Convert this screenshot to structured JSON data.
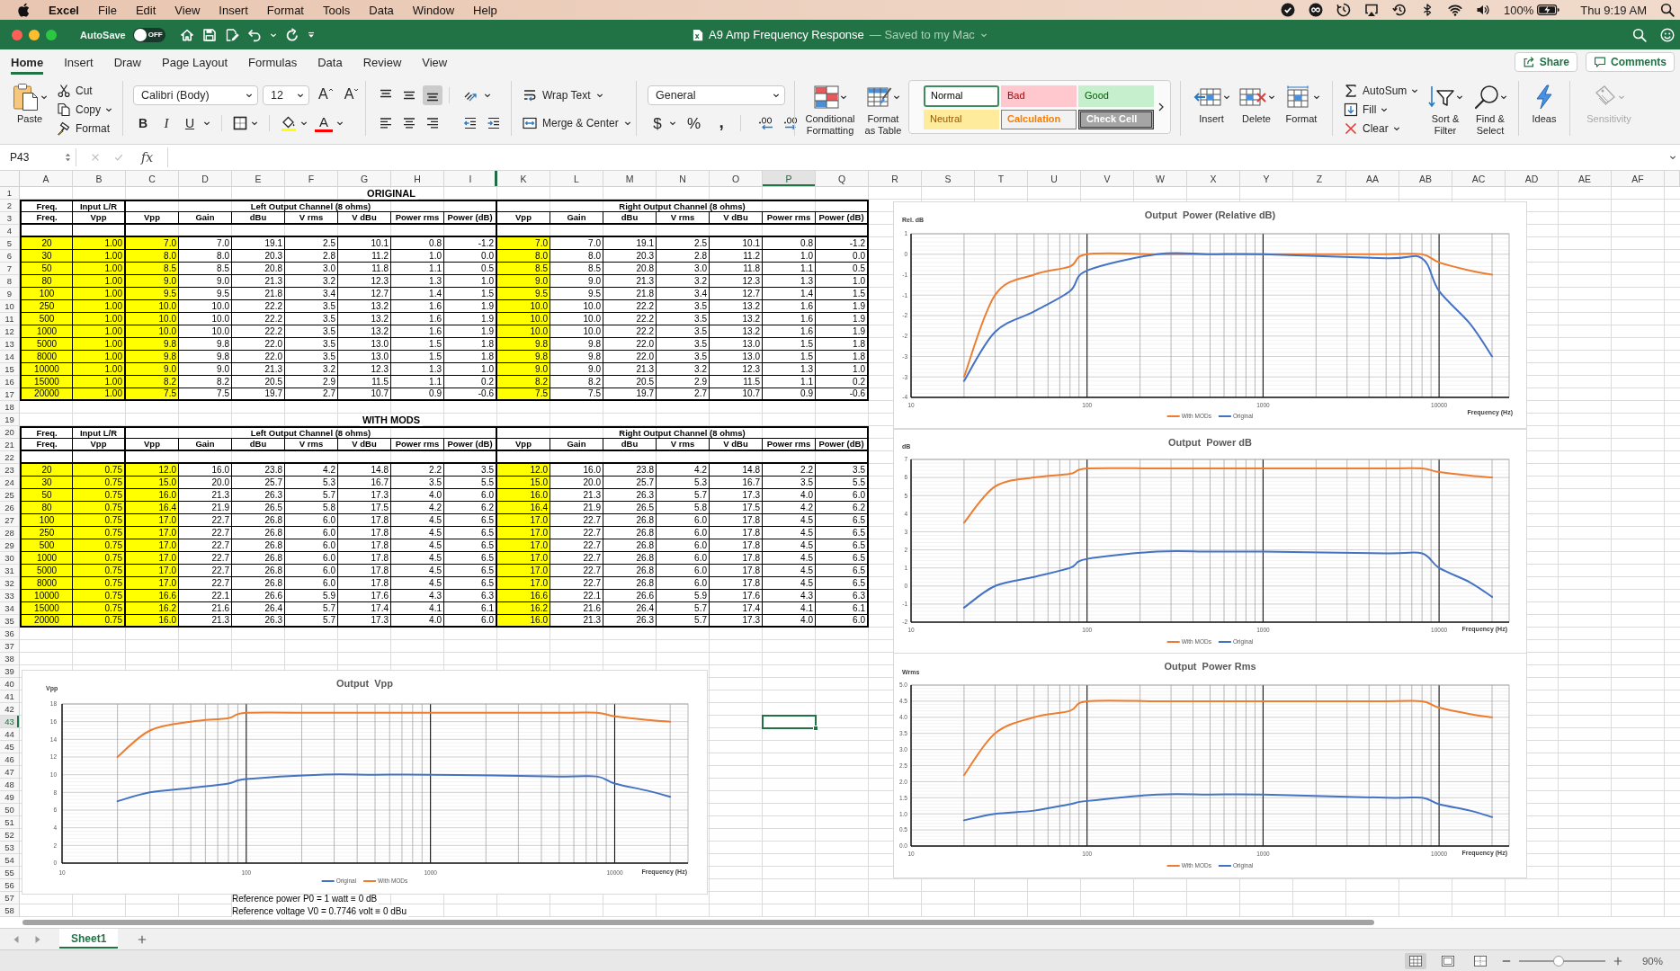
{
  "menu_bar": {
    "app": "Excel",
    "items": [
      "File",
      "Edit",
      "View",
      "Insert",
      "Format",
      "Tools",
      "Data",
      "Window",
      "Help"
    ],
    "battery": "100%",
    "clock": "Thu 9:19 AM"
  },
  "title_bar": {
    "autosave": {
      "label": "AutoSave",
      "on": false,
      "toggle_text": "OFF"
    },
    "title": "A9 Amp Frequency Response",
    "save_status": "— Saved to my Mac"
  },
  "ribbon": {
    "tabs": [
      {
        "label": "Home",
        "selected": true
      },
      {
        "label": "Insert",
        "selected": false
      },
      {
        "label": "Draw",
        "selected": false
      },
      {
        "label": "Page Layout",
        "selected": false
      },
      {
        "label": "Formulas",
        "selected": false
      },
      {
        "label": "Data",
        "selected": false
      },
      {
        "label": "Review",
        "selected": false
      },
      {
        "label": "View",
        "selected": false
      }
    ],
    "share": "Share",
    "comments": "Comments",
    "clipboard": {
      "paste": "Paste",
      "cut": "Cut",
      "copy": "Copy",
      "format": "Format"
    },
    "font": {
      "family": "Calibri (Body)",
      "size": "12",
      "grow": "A",
      "shrink": "A",
      "styles": [
        {
          "kind": "bold",
          "label": "B",
          "selected": false
        },
        {
          "kind": "italic",
          "label": "I",
          "selected": false
        },
        {
          "kind": "underline",
          "label": "U",
          "selected": false
        }
      ],
      "font_color": "A"
    },
    "alignment": {
      "vertical": [
        {
          "kind": "top",
          "selected": false
        },
        {
          "kind": "middle",
          "selected": false
        },
        {
          "kind": "bottom",
          "selected": true
        }
      ],
      "horizontal": [
        {
          "kind": "left",
          "selected": false
        },
        {
          "kind": "center",
          "selected": false
        },
        {
          "kind": "right",
          "selected": false
        }
      ],
      "wrap_text": "Wrap Text",
      "merge_center": "Merge & Center"
    },
    "number": {
      "format": "General",
      "buttons": [
        {
          "kind": "currency",
          "label": "$"
        },
        {
          "kind": "percent",
          "label": "%"
        },
        {
          "kind": "comma",
          "label": ","
        }
      ]
    },
    "conditional_formatting": "Conditional Formatting",
    "format_as_table": "Format as Table",
    "styles": [
      {
        "label": "Normal",
        "kind": "normal",
        "selected": true
      },
      {
        "label": "Bad",
        "kind": "bad",
        "selected": false
      },
      {
        "label": "Good",
        "kind": "good",
        "selected": false
      },
      {
        "label": "Neutral",
        "kind": "neutral",
        "selected": false
      },
      {
        "label": "Calculation",
        "kind": "calculation",
        "selected": false
      },
      {
        "label": "Check Cell",
        "kind": "check",
        "selected": false
      }
    ],
    "cells": [
      {
        "label": "Insert",
        "kind": "insert"
      },
      {
        "label": "Delete",
        "kind": "delete"
      },
      {
        "label": "Format",
        "kind": "format"
      }
    ],
    "editing": {
      "autosum": "AutoSum",
      "fill": "Fill",
      "clear": "Clear",
      "sort_filter": "Sort & Filter",
      "find_select": "Find & Select"
    },
    "ideas": "Ideas",
    "sensitivity": {
      "label": "Sensitivity",
      "disabled": true
    }
  },
  "formula_bar": {
    "name_box": "P43",
    "function_label": "fx"
  },
  "sheet": {
    "columns": [
      {
        "label": "A",
        "selected": false,
        "hidden_before": false
      },
      {
        "label": "B",
        "selected": false,
        "hidden_before": false
      },
      {
        "label": "C",
        "selected": false,
        "hidden_before": false
      },
      {
        "label": "D",
        "selected": false,
        "hidden_before": false
      },
      {
        "label": "E",
        "selected": false,
        "hidden_before": false
      },
      {
        "label": "F",
        "selected": false,
        "hidden_before": false
      },
      {
        "label": "G",
        "selected": false,
        "hidden_before": false
      },
      {
        "label": "H",
        "selected": false,
        "hidden_before": false
      },
      {
        "label": "I",
        "selected": false,
        "hidden_before": false
      },
      {
        "label": "K",
        "selected": false,
        "hidden_before": true
      },
      {
        "label": "L",
        "selected": false,
        "hidden_before": false
      },
      {
        "label": "M",
        "selected": false,
        "hidden_before": false
      },
      {
        "label": "N",
        "selected": false,
        "hidden_before": false
      },
      {
        "label": "O",
        "selected": false,
        "hidden_before": false
      },
      {
        "label": "P",
        "selected": true,
        "hidden_before": false
      },
      {
        "label": "Q",
        "selected": false,
        "hidden_before": false
      },
      {
        "label": "R",
        "selected": false,
        "hidden_before": false
      },
      {
        "label": "S",
        "selected": false,
        "hidden_before": false
      },
      {
        "label": "T",
        "selected": false,
        "hidden_before": false
      },
      {
        "label": "U",
        "selected": false,
        "hidden_before": false
      },
      {
        "label": "V",
        "selected": false,
        "hidden_before": false
      },
      {
        "label": "W",
        "selected": false,
        "hidden_before": false
      },
      {
        "label": "X",
        "selected": false,
        "hidden_before": false
      },
      {
        "label": "Y",
        "selected": false,
        "hidden_before": false
      },
      {
        "label": "Z",
        "selected": false,
        "hidden_before": false
      },
      {
        "label": "AA",
        "selected": false,
        "hidden_before": false
      },
      {
        "label": "AB",
        "selected": false,
        "hidden_before": false
      },
      {
        "label": "AC",
        "selected": false,
        "hidden_before": false
      },
      {
        "label": "AD",
        "selected": false,
        "hidden_before": false
      },
      {
        "label": "AE",
        "selected": false,
        "hidden_before": false
      },
      {
        "label": "AF",
        "selected": false,
        "hidden_before": false
      }
    ],
    "rows": [
      {
        "label": "1",
        "selected": false
      },
      {
        "label": "2",
        "selected": false
      },
      {
        "label": "3",
        "selected": false
      },
      {
        "label": "4",
        "selected": false
      },
      {
        "label": "5",
        "selected": false
      },
      {
        "label": "6",
        "selected": false
      },
      {
        "label": "7",
        "selected": false
      },
      {
        "label": "8",
        "selected": false
      },
      {
        "label": "9",
        "selected": false
      },
      {
        "label": "10",
        "selected": false
      },
      {
        "label": "11",
        "selected": false
      },
      {
        "label": "12",
        "selected": false
      },
      {
        "label": "13",
        "selected": false
      },
      {
        "label": "14",
        "selected": false
      },
      {
        "label": "15",
        "selected": false
      },
      {
        "label": "16",
        "selected": false
      },
      {
        "label": "17",
        "selected": false
      },
      {
        "label": "18",
        "selected": false
      },
      {
        "label": "19",
        "selected": false
      },
      {
        "label": "20",
        "selected": false
      },
      {
        "label": "21",
        "selected": false
      },
      {
        "label": "22",
        "selected": false
      },
      {
        "label": "23",
        "selected": false
      },
      {
        "label": "24",
        "selected": false
      },
      {
        "label": "25",
        "selected": false
      },
      {
        "label": "26",
        "selected": false
      },
      {
        "label": "27",
        "selected": false
      },
      {
        "label": "28",
        "selected": false
      },
      {
        "label": "29",
        "selected": false
      },
      {
        "label": "30",
        "selected": false
      },
      {
        "label": "31",
        "selected": false
      },
      {
        "label": "32",
        "selected": false
      },
      {
        "label": "33",
        "selected": false
      },
      {
        "label": "34",
        "selected": false
      },
      {
        "label": "35",
        "selected": false
      },
      {
        "label": "36",
        "selected": false
      },
      {
        "label": "37",
        "selected": false
      },
      {
        "label": "38",
        "selected": false
      },
      {
        "label": "39",
        "selected": false
      },
      {
        "label": "40",
        "selected": false
      },
      {
        "label": "41",
        "selected": false
      },
      {
        "label": "42",
        "selected": false
      },
      {
        "label": "43",
        "selected": true
      },
      {
        "label": "44",
        "selected": false
      },
      {
        "label": "45",
        "selected": false
      },
      {
        "label": "46",
        "selected": false
      },
      {
        "label": "47",
        "selected": false
      },
      {
        "label": "48",
        "selected": false
      },
      {
        "label": "49",
        "selected": false
      },
      {
        "label": "50",
        "selected": false
      },
      {
        "label": "51",
        "selected": false
      },
      {
        "label": "52",
        "selected": false
      },
      {
        "label": "53",
        "selected": false
      },
      {
        "label": "54",
        "selected": false
      },
      {
        "label": "55",
        "selected": false
      },
      {
        "label": "56",
        "selected": false
      },
      {
        "label": "57",
        "selected": false
      },
      {
        "label": "58",
        "selected": false
      }
    ],
    "tables": [
      {
        "title": "ORIGINAL",
        "group_headers": [
          "Freq.",
          "Input L/R",
          "Left Output Channel (8 ohms)",
          "Right Output Channel (8 ohms)"
        ],
        "column_headers": [
          "Freq.",
          "Vpp",
          "Vpp",
          "Gain",
          "dBu",
          "V rms",
          "V dBu",
          "Power rms",
          "Power (dB)",
          "Vpp",
          "Gain",
          "dBu",
          "V rms",
          "V dBu",
          "Power rms",
          "Power (dB)"
        ],
        "rows": [
          [
            "20",
            "1.00",
            "7.0",
            "7.0",
            "19.1",
            "2.5",
            "10.1",
            "0.8",
            "-1.2",
            "7.0",
            "7.0",
            "19.1",
            "2.5",
            "10.1",
            "0.8",
            "-1.2"
          ],
          [
            "30",
            "1.00",
            "8.0",
            "8.0",
            "20.3",
            "2.8",
            "11.2",
            "1.0",
            "0.0",
            "8.0",
            "8.0",
            "20.3",
            "2.8",
            "11.2",
            "1.0",
            "0.0"
          ],
          [
            "50",
            "1.00",
            "8.5",
            "8.5",
            "20.8",
            "3.0",
            "11.8",
            "1.1",
            "0.5",
            "8.5",
            "8.5",
            "20.8",
            "3.0",
            "11.8",
            "1.1",
            "0.5"
          ],
          [
            "80",
            "1.00",
            "9.0",
            "9.0",
            "21.3",
            "3.2",
            "12.3",
            "1.3",
            "1.0",
            "9.0",
            "9.0",
            "21.3",
            "3.2",
            "12.3",
            "1.3",
            "1.0"
          ],
          [
            "100",
            "1.00",
            "9.5",
            "9.5",
            "21.8",
            "3.4",
            "12.7",
            "1.4",
            "1.5",
            "9.5",
            "9.5",
            "21.8",
            "3.4",
            "12.7",
            "1.4",
            "1.5"
          ],
          [
            "250",
            "1.00",
            "10.0",
            "10.0",
            "22.2",
            "3.5",
            "13.2",
            "1.6",
            "1.9",
            "10.0",
            "10.0",
            "22.2",
            "3.5",
            "13.2",
            "1.6",
            "1.9"
          ],
          [
            "500",
            "1.00",
            "10.0",
            "10.0",
            "22.2",
            "3.5",
            "13.2",
            "1.6",
            "1.9",
            "10.0",
            "10.0",
            "22.2",
            "3.5",
            "13.2",
            "1.6",
            "1.9"
          ],
          [
            "1000",
            "1.00",
            "10.0",
            "10.0",
            "22.2",
            "3.5",
            "13.2",
            "1.6",
            "1.9",
            "10.0",
            "10.0",
            "22.2",
            "3.5",
            "13.2",
            "1.6",
            "1.9"
          ],
          [
            "5000",
            "1.00",
            "9.8",
            "9.8",
            "22.0",
            "3.5",
            "13.0",
            "1.5",
            "1.8",
            "9.8",
            "9.8",
            "22.0",
            "3.5",
            "13.0",
            "1.5",
            "1.8"
          ],
          [
            "8000",
            "1.00",
            "9.8",
            "9.8",
            "22.0",
            "3.5",
            "13.0",
            "1.5",
            "1.8",
            "9.8",
            "9.8",
            "22.0",
            "3.5",
            "13.0",
            "1.5",
            "1.8"
          ],
          [
            "10000",
            "1.00",
            "9.0",
            "9.0",
            "21.3",
            "3.2",
            "12.3",
            "1.3",
            "1.0",
            "9.0",
            "9.0",
            "21.3",
            "3.2",
            "12.3",
            "1.3",
            "1.0"
          ],
          [
            "15000",
            "1.00",
            "8.2",
            "8.2",
            "20.5",
            "2.9",
            "11.5",
            "1.1",
            "0.2",
            "8.2",
            "8.2",
            "20.5",
            "2.9",
            "11.5",
            "1.1",
            "0.2"
          ],
          [
            "20000",
            "1.00",
            "7.5",
            "7.5",
            "19.7",
            "2.7",
            "10.7",
            "0.9",
            "-0.6",
            "7.5",
            "7.5",
            "19.7",
            "2.7",
            "10.7",
            "0.9",
            "-0.6"
          ]
        ]
      },
      {
        "title": "WITH MODS",
        "group_headers": [
          "Freq.",
          "Input L/R",
          "Left Output Channel (8 ohms)",
          "Right Output Channel (8 ohms)"
        ],
        "column_headers": [
          "Freq.",
          "Vpp",
          "Vpp",
          "Gain",
          "dBu",
          "V rms",
          "V dBu",
          "Power rms",
          "Power (dB)",
          "Vpp",
          "Gain",
          "dBu",
          "V rms",
          "V dBu",
          "Power rms",
          "Power (dB)"
        ],
        "rows": [
          [
            "20",
            "0.75",
            "12.0",
            "16.0",
            "23.8",
            "4.2",
            "14.8",
            "2.2",
            "3.5",
            "12.0",
            "16.0",
            "23.8",
            "4.2",
            "14.8",
            "2.2",
            "3.5"
          ],
          [
            "30",
            "0.75",
            "15.0",
            "20.0",
            "25.7",
            "5.3",
            "16.7",
            "3.5",
            "5.5",
            "15.0",
            "20.0",
            "25.7",
            "5.3",
            "16.7",
            "3.5",
            "5.5"
          ],
          [
            "50",
            "0.75",
            "16.0",
            "21.3",
            "26.3",
            "5.7",
            "17.3",
            "4.0",
            "6.0",
            "16.0",
            "21.3",
            "26.3",
            "5.7",
            "17.3",
            "4.0",
            "6.0"
          ],
          [
            "80",
            "0.75",
            "16.4",
            "21.9",
            "26.5",
            "5.8",
            "17.5",
            "4.2",
            "6.2",
            "16.4",
            "21.9",
            "26.5",
            "5.8",
            "17.5",
            "4.2",
            "6.2"
          ],
          [
            "100",
            "0.75",
            "17.0",
            "22.7",
            "26.8",
            "6.0",
            "17.8",
            "4.5",
            "6.5",
            "17.0",
            "22.7",
            "26.8",
            "6.0",
            "17.8",
            "4.5",
            "6.5"
          ],
          [
            "250",
            "0.75",
            "17.0",
            "22.7",
            "26.8",
            "6.0",
            "17.8",
            "4.5",
            "6.5",
            "17.0",
            "22.7",
            "26.8",
            "6.0",
            "17.8",
            "4.5",
            "6.5"
          ],
          [
            "500",
            "0.75",
            "17.0",
            "22.7",
            "26.8",
            "6.0",
            "17.8",
            "4.5",
            "6.5",
            "17.0",
            "22.7",
            "26.8",
            "6.0",
            "17.8",
            "4.5",
            "6.5"
          ],
          [
            "1000",
            "0.75",
            "17.0",
            "22.7",
            "26.8",
            "6.0",
            "17.8",
            "4.5",
            "6.5",
            "17.0",
            "22.7",
            "26.8",
            "6.0",
            "17.8",
            "4.5",
            "6.5"
          ],
          [
            "5000",
            "0.75",
            "17.0",
            "22.7",
            "26.8",
            "6.0",
            "17.8",
            "4.5",
            "6.5",
            "17.0",
            "22.7",
            "26.8",
            "6.0",
            "17.8",
            "4.5",
            "6.5"
          ],
          [
            "8000",
            "0.75",
            "17.0",
            "22.7",
            "26.8",
            "6.0",
            "17.8",
            "4.5",
            "6.5",
            "17.0",
            "22.7",
            "26.8",
            "6.0",
            "17.8",
            "4.5",
            "6.5"
          ],
          [
            "10000",
            "0.75",
            "16.6",
            "22.1",
            "26.6",
            "5.9",
            "17.6",
            "4.3",
            "6.3",
            "16.6",
            "22.1",
            "26.6",
            "5.9",
            "17.6",
            "4.3",
            "6.3"
          ],
          [
            "15000",
            "0.75",
            "16.2",
            "21.6",
            "26.4",
            "5.7",
            "17.4",
            "4.1",
            "6.1",
            "16.2",
            "21.6",
            "26.4",
            "5.7",
            "17.4",
            "4.1",
            "6.1"
          ],
          [
            "20000",
            "0.75",
            "16.0",
            "21.3",
            "26.3",
            "5.7",
            "17.3",
            "4.0",
            "6.0",
            "16.0",
            "21.3",
            "26.3",
            "5.7",
            "17.3",
            "4.0",
            "6.0"
          ]
        ]
      }
    ],
    "charts": [
      {
        "chart_data": {
          "type": "line",
          "title": "Output  Power (Relative dB)",
          "xlabel": "Frequency (Hz)",
          "ylabel": "Rel. dB",
          "log": "x",
          "grid": true,
          "legend": "bottom",
          "x": [
            20,
            30,
            50,
            80,
            100,
            250,
            500,
            1000,
            5000,
            8000,
            10000,
            15000,
            20000
          ],
          "series": [
            {
              "name": "With MODs",
              "color": "#ed7d31",
              "values": [
                -3.0,
                -1.0,
                -0.5,
                -0.3,
                0.0,
                0.0,
                0.0,
                0.0,
                0.0,
                0.0,
                -0.2,
                -0.4,
                -0.5
              ]
            },
            {
              "name": "Original",
              "color": "#4472c4",
              "values": [
                -3.1,
                -1.9,
                -1.4,
                -0.9,
                -0.4,
                0.0,
                0.0,
                0.0,
                -0.1,
                -0.1,
                -0.9,
                -1.7,
                -2.5
              ]
            }
          ],
          "xlim": [
            10,
            25000
          ],
          "ylim": [
            -3.5,
            0.5
          ],
          "xticks": [
            10,
            100,
            1000,
            10000
          ],
          "yticks": [
            {
              "value": 0.5,
              "label": "1"
            },
            {
              "value": 0,
              "label": "0"
            },
            {
              "value": -0.5,
              "label": "-1"
            },
            {
              "value": -1,
              "label": "-1"
            },
            {
              "value": -1.5,
              "label": "-2"
            },
            {
              "value": -2,
              "label": "-2"
            },
            {
              "value": -2.5,
              "label": "-3"
            },
            {
              "value": -3,
              "label": "-3"
            },
            {
              "value": -3.5,
              "label": "-4"
            }
          ]
        }
      },
      {
        "chart_data": {
          "type": "line",
          "title": "Output  Power dB",
          "xlabel": "Frequency (Hz)",
          "ylabel": "dB",
          "log": "x",
          "grid": true,
          "legend": "bottom",
          "x": [
            20,
            30,
            50,
            80,
            100,
            250,
            500,
            1000,
            5000,
            8000,
            10000,
            15000,
            20000
          ],
          "series": [
            {
              "name": "With MODs",
              "color": "#ed7d31",
              "values": [
                3.5,
                5.5,
                6.0,
                6.2,
                6.5,
                6.5,
                6.5,
                6.5,
                6.5,
                6.5,
                6.3,
                6.1,
                6.0
              ]
            },
            {
              "name": "Original",
              "color": "#4472c4",
              "values": [
                -1.2,
                0.0,
                0.5,
                1.0,
                1.5,
                1.9,
                1.9,
                1.9,
                1.8,
                1.8,
                1.0,
                0.2,
                -0.6
              ]
            }
          ],
          "xlim": [
            10,
            25000
          ],
          "ylim": [
            -2,
            7
          ],
          "xticks": [
            10,
            100,
            1000,
            10000
          ],
          "yticks": [
            -2,
            -1,
            0,
            1,
            2,
            3,
            4,
            5,
            6,
            7
          ]
        }
      },
      {
        "chart_data": {
          "type": "line",
          "title": "Output  Power Rms",
          "xlabel": "Frequency (Hz)",
          "ylabel": "Wrms",
          "log": "x",
          "grid": true,
          "legend": "bottom",
          "x": [
            20,
            30,
            50,
            80,
            100,
            250,
            500,
            1000,
            5000,
            8000,
            10000,
            15000,
            20000
          ],
          "series": [
            {
              "name": "With MODs",
              "color": "#ed7d31",
              "values": [
                2.2,
                3.5,
                4.0,
                4.2,
                4.5,
                4.5,
                4.5,
                4.5,
                4.5,
                4.5,
                4.3,
                4.1,
                4.0
              ]
            },
            {
              "name": "Original",
              "color": "#4472c4",
              "values": [
                0.8,
                1.0,
                1.1,
                1.3,
                1.4,
                1.6,
                1.6,
                1.6,
                1.5,
                1.5,
                1.3,
                1.1,
                0.9
              ]
            }
          ],
          "xlim": [
            10,
            25000
          ],
          "ylim": [
            0,
            5
          ],
          "xticks": [
            10,
            100,
            1000,
            10000
          ],
          "yticks": [
            {
              "value": 0,
              "label": "0.0"
            },
            {
              "value": 0.5,
              "label": "0.5"
            },
            {
              "value": 1,
              "label": "1.0"
            },
            {
              "value": 1.5,
              "label": "1.5"
            },
            {
              "value": 2,
              "label": "2.0"
            },
            {
              "value": 2.5,
              "label": "2.5"
            },
            {
              "value": 3,
              "label": "3.0"
            },
            {
              "value": 3.5,
              "label": "3.5"
            },
            {
              "value": 4,
              "label": "4.0"
            },
            {
              "value": 4.5,
              "label": "4.5"
            },
            {
              "value": 5,
              "label": "5.0"
            }
          ]
        }
      },
      {
        "chart_data": {
          "type": "line",
          "title": "Output  Vpp",
          "xlabel": "Frequency (Hz)",
          "ylabel": "Vpp",
          "log": "x",
          "grid": true,
          "legend": "bottom",
          "x": [
            20,
            30,
            50,
            80,
            100,
            250,
            500,
            1000,
            5000,
            8000,
            10000,
            15000,
            20000
          ],
          "series": [
            {
              "name": "Original",
              "color": "#4472c4",
              "values": [
                7.0,
                8.0,
                8.5,
                9.0,
                9.5,
                10.0,
                10.0,
                10.0,
                9.8,
                9.8,
                9.0,
                8.2,
                7.5
              ]
            },
            {
              "name": "With MODs",
              "color": "#ed7d31",
              "values": [
                12.0,
                15.0,
                16.0,
                16.4,
                17.0,
                17.0,
                17.0,
                17.0,
                17.0,
                17.0,
                16.6,
                16.2,
                16.0
              ]
            }
          ],
          "xlim": [
            10,
            25000
          ],
          "ylim": [
            0,
            18
          ],
          "xticks": [
            10,
            100,
            1000,
            10000
          ],
          "yticks": [
            0,
            2,
            4,
            6,
            8,
            10,
            12,
            14,
            16,
            18
          ]
        }
      }
    ],
    "notes": [
      "Reference power P0 = 1 watt ≡ 0 dB",
      "Reference voltage V0 = 0.7746 volt ≡ 0 dBu"
    ]
  },
  "sheet_tabs": [
    {
      "label": "Sheet1",
      "selected": true
    }
  ],
  "status_bar": {
    "views": [
      {
        "kind": "normal",
        "selected": true
      },
      {
        "kind": "page_layout",
        "selected": false
      },
      {
        "kind": "page_break",
        "selected": false
      }
    ],
    "zoom": {
      "level": 0.46,
      "reading": "90%"
    }
  }
}
